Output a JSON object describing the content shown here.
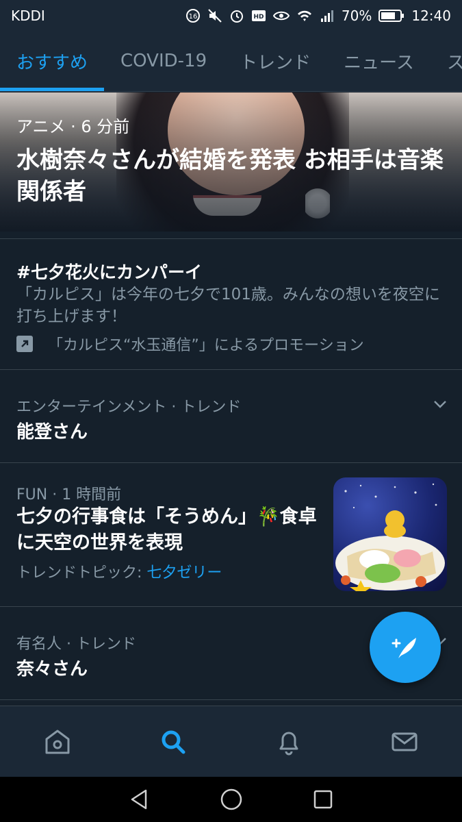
{
  "status_bar": {
    "carrier": "KDDI",
    "battery": "70%",
    "time": "12:40"
  },
  "tabs": [
    {
      "label": "おすすめ",
      "active": true
    },
    {
      "label": "COVID-19",
      "active": false
    },
    {
      "label": "トレンド",
      "active": false
    },
    {
      "label": "ニュース",
      "active": false
    },
    {
      "label": "ス",
      "active": false
    }
  ],
  "hero": {
    "meta": "アニメ · 6 分前",
    "headline": "水樹奈々さんが結婚を発表 お相手は音楽関係者"
  },
  "promo": {
    "tag": "#七夕花火にカンパーイ",
    "description": "「カルピス」は今年の七夕で101歳。みんなの想いを夜空に打ち上げます！",
    "promoted_by": "「カルピス“水玉通信”」によるプロモーション"
  },
  "entertainment_trend": {
    "category": "エンターテインメント · トレンド",
    "name": "能登さん"
  },
  "fun_item": {
    "category": "FUN · 1 時間前",
    "title": "七夕の行事食は「そうめん」🎋食卓に天空の世界を表現",
    "topic_prefix": "トレンドトピック: ",
    "topic_link": "七夕ゼリー"
  },
  "celebrity_trend": {
    "category": "有名人 · トレンド",
    "name": "奈々さん"
  },
  "colors": {
    "background": "#15202b",
    "accent": "#1da1f2",
    "secondary_text": "#8899a6"
  },
  "icons": [
    "home-icon",
    "search-icon",
    "bell-icon",
    "mail-icon",
    "compose-tweet-icon",
    "back-icon",
    "home-circle-icon",
    "recents-icon"
  ]
}
